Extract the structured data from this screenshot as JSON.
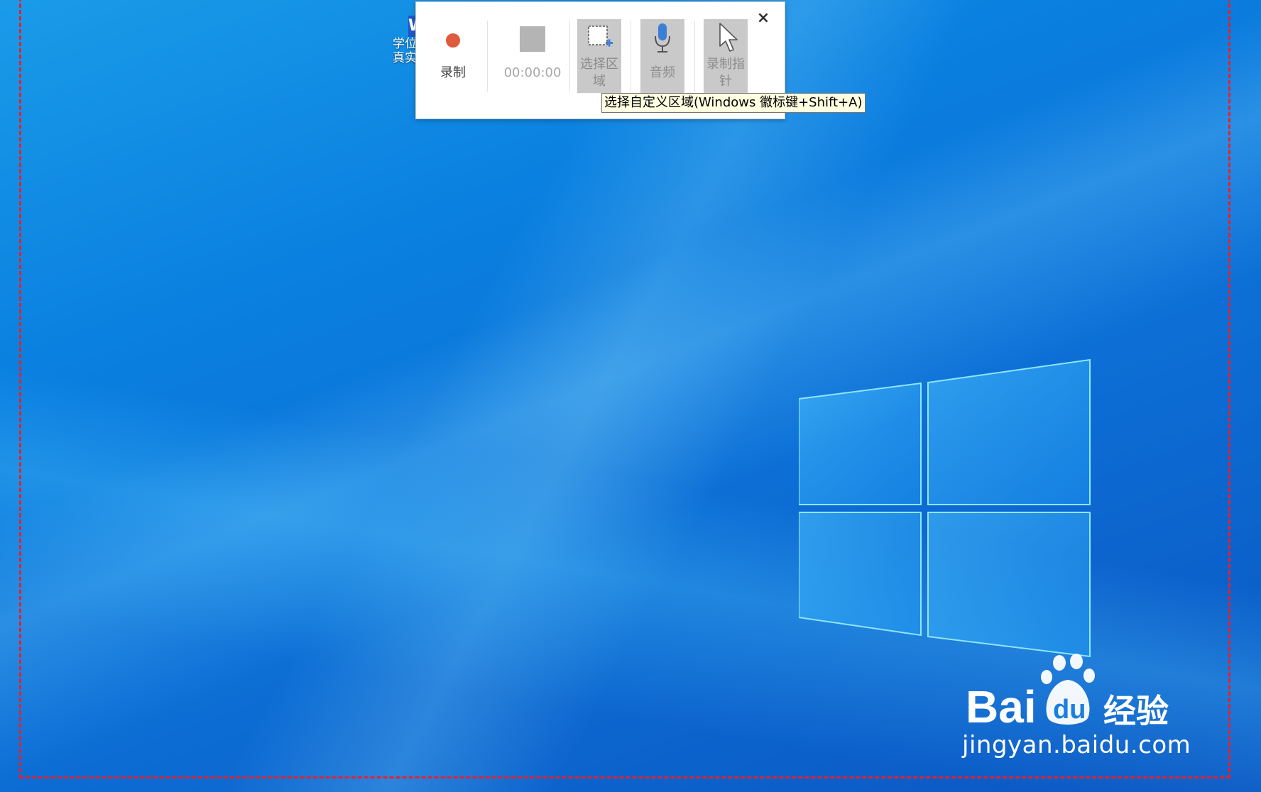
{
  "desktop": {
    "icon_label": "学位\n真实",
    "icon_glyph": "W"
  },
  "recorder": {
    "record_label": "录制",
    "timer": "00:00:00",
    "select_area_label": "选择区\n域",
    "audio_label": "音频",
    "pointer_label": "录制指\n针",
    "close_glyph": "×"
  },
  "tooltip": {
    "text": "选择自定义区域(Windows 徽标键+Shift+A)"
  },
  "watermark": {
    "brand": "Bai du 经验",
    "url": "jingyan.baidu.com"
  },
  "colors": {
    "record_dot": "#e05a3e",
    "selection_border": "#e8202a",
    "tooltip_bg": "#ffffe1",
    "accent_blue": "#3b7fd6"
  }
}
